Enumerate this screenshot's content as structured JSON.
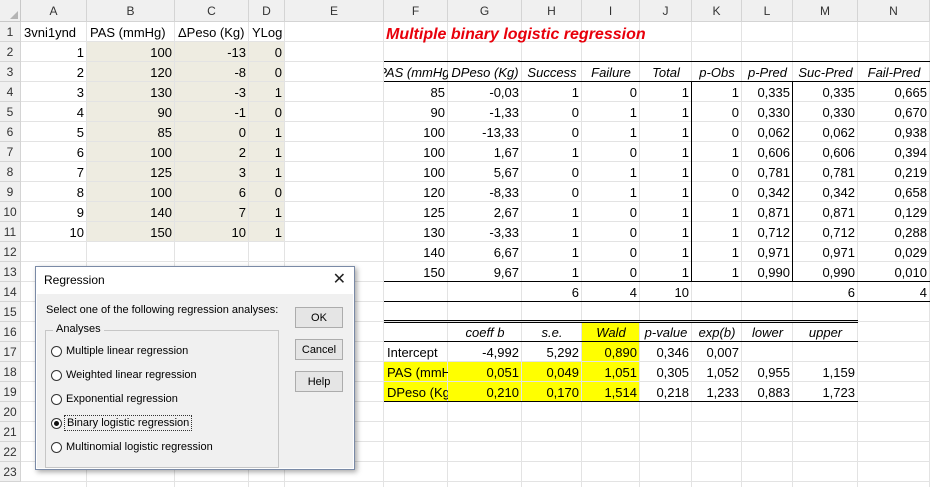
{
  "title": "Multiple binary logistic regression",
  "columns": [
    "A",
    "B",
    "C",
    "D",
    "E",
    "F",
    "G",
    "H",
    "I",
    "J",
    "K",
    "L",
    "M",
    "N"
  ],
  "rows": [
    "1",
    "2",
    "3",
    "4",
    "5",
    "6",
    "7",
    "8",
    "9",
    "10",
    "11",
    "12",
    "13",
    "14",
    "15",
    "16",
    "17",
    "18",
    "19",
    "20",
    "21",
    "22",
    "23"
  ],
  "colors": {
    "beige": "#eeece1",
    "yellow": "#ffff00",
    "title_red": "#e8000b"
  },
  "input": {
    "headers": [
      "3vni1ynd",
      "PAS (mmHg)",
      "ΔPeso (Kg)",
      "YLog"
    ],
    "rows": [
      [
        "1",
        "100",
        "-13",
        "0"
      ],
      [
        "2",
        "120",
        "-8",
        "0"
      ],
      [
        "3",
        "130",
        "-3",
        "1"
      ],
      [
        "4",
        "90",
        "-1",
        "0"
      ],
      [
        "5",
        "85",
        "0",
        "1"
      ],
      [
        "6",
        "100",
        "2",
        "1"
      ],
      [
        "7",
        "125",
        "3",
        "1"
      ],
      [
        "8",
        "100",
        "6",
        "0"
      ],
      [
        "9",
        "140",
        "7",
        "1"
      ],
      [
        "10",
        "150",
        "10",
        "1"
      ]
    ]
  },
  "results": {
    "headers": [
      "PAS (mmHg)",
      "DPeso (Kg)",
      "Success",
      "Failure",
      "Total",
      "p-Obs",
      "p-Pred",
      "Suc-Pred",
      "Fail-Pred"
    ],
    "rows": [
      [
        "85",
        "-0,03",
        "1",
        "0",
        "1",
        "1",
        "0,335",
        "0,335",
        "0,665"
      ],
      [
        "90",
        "-1,33",
        "0",
        "1",
        "1",
        "0",
        "0,330",
        "0,330",
        "0,670"
      ],
      [
        "100",
        "-13,33",
        "0",
        "1",
        "1",
        "0",
        "0,062",
        "0,062",
        "0,938"
      ],
      [
        "100",
        "1,67",
        "1",
        "0",
        "1",
        "1",
        "0,606",
        "0,606",
        "0,394"
      ],
      [
        "100",
        "5,67",
        "0",
        "1",
        "1",
        "0",
        "0,781",
        "0,781",
        "0,219"
      ],
      [
        "120",
        "-8,33",
        "0",
        "1",
        "1",
        "0",
        "0,342",
        "0,342",
        "0,658"
      ],
      [
        "125",
        "2,67",
        "1",
        "0",
        "1",
        "1",
        "0,871",
        "0,871",
        "0,129"
      ],
      [
        "130",
        "-3,33",
        "1",
        "0",
        "1",
        "1",
        "0,712",
        "0,712",
        "0,288"
      ],
      [
        "140",
        "6,67",
        "1",
        "0",
        "1",
        "1",
        "0,971",
        "0,971",
        "0,029"
      ],
      [
        "150",
        "9,67",
        "1",
        "0",
        "1",
        "1",
        "0,990",
        "0,990",
        "0,010"
      ]
    ],
    "totals": {
      "success": "6",
      "failure": "4",
      "total": "10",
      "suc_pred": "6",
      "fail_pred": "4"
    }
  },
  "coef": {
    "headers": [
      "coeff b",
      "s.e.",
      "Wald",
      "p-value",
      "exp(b)",
      "lower",
      "upper"
    ],
    "rows": [
      [
        "Intercept",
        "-4,992",
        "5,292",
        "0,890",
        "0,346",
        "0,007",
        "",
        ""
      ],
      [
        "PAS (mmHg)",
        "0,051",
        "0,049",
        "1,051",
        "0,305",
        "1,052",
        "0,955",
        "1,159"
      ],
      [
        "DPeso (Kg)",
        "0,210",
        "0,170",
        "1,514",
        "0,218",
        "1,233",
        "0,883",
        "1,723"
      ]
    ]
  },
  "dialog": {
    "title": "Regression",
    "close": "✕",
    "prompt": "Select one of the following regression analyses:",
    "group": "Analyses",
    "options": [
      "Multiple linear regression",
      "Weighted linear regression",
      "Exponential regression",
      "Binary logistic regression",
      "Multinomial logistic regression"
    ],
    "selected": 3,
    "buttons": {
      "ok": "OK",
      "cancel": "Cancel",
      "help": "Help"
    }
  }
}
